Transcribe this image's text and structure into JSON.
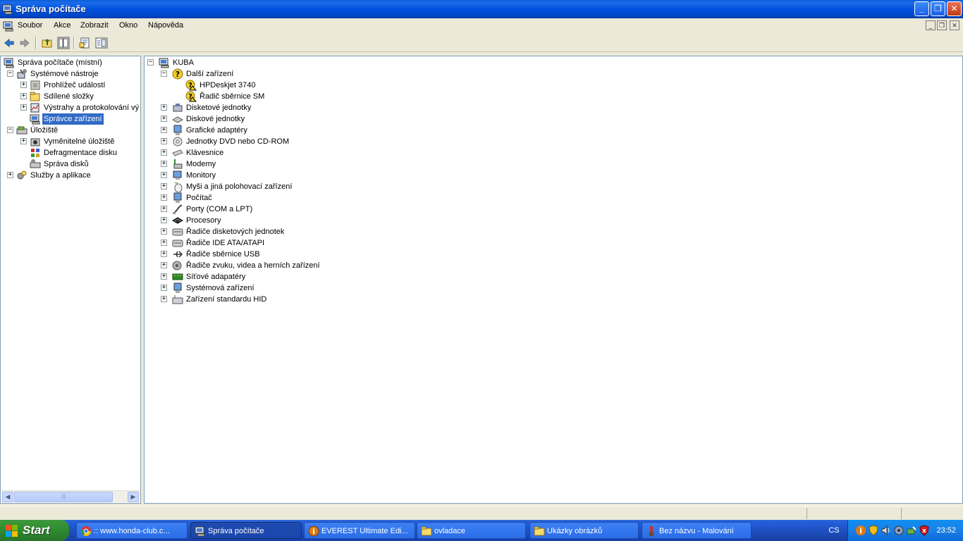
{
  "window": {
    "title": "Správa počítače"
  },
  "menu": [
    "Soubor",
    "Akce",
    "Zobrazit",
    "Okno",
    "Nápověda"
  ],
  "left_tree": {
    "root": "Správa počítače (místní)",
    "system_tools": "Systémové nástroje",
    "event_viewer": "Prohlížeč událostí",
    "shared_folders": "Sdílené složky",
    "alerts": "Výstrahy a protokolování vý",
    "device_manager": "Správce zařízení",
    "storage": "Úložiště",
    "removable": "Vyměnitelné úložiště",
    "defrag": "Defragmentace disku",
    "disk_mgmt": "Správa disků",
    "services": "Služby a aplikace"
  },
  "right_tree": {
    "computer": "KUBA",
    "other_devices": "Další zařízení",
    "other_children": [
      "HPDeskjet 3740",
      "Řadič sběrnice SM"
    ],
    "categories": [
      "Disketové jednotky",
      "Diskové jednotky",
      "Grafické adaptéry",
      "Jednotky DVD nebo CD-ROM",
      "Klávesnice",
      "Modemy",
      "Monitory",
      "Myši a jiná polohovací zařízení",
      "Počítač",
      "Porty (COM a LPT)",
      "Procesory",
      "Řadiče disketových jednotek",
      "Řadiče IDE ATA/ATAPI",
      "Řadiče sběrnice USB",
      "Řadiče zvuku, videa a herních zařízení",
      "Síťové adapatéry",
      "Systémová zařízení",
      "Zařízení standardu HID"
    ]
  },
  "taskbar": {
    "start": "Start",
    "tasks": [
      ":: www.honda-club.c...",
      "Správa počítače",
      "EVEREST Ultimate Edi...",
      "ovladace",
      "Ukázky obrázků",
      "Bez názvu - Malování"
    ],
    "lang": "CS",
    "clock": "23:52"
  }
}
